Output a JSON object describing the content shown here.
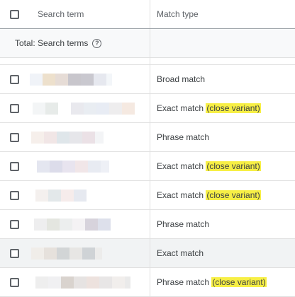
{
  "header": {
    "search_term_label": "Search term",
    "match_type_label": "Match type"
  },
  "total": {
    "label": "Total: Search terms",
    "help_icon": "?"
  },
  "rows": [
    {
      "match": "Broad match",
      "variant": "",
      "blur": [
        [
          "#f0f3f8",
          18
        ],
        [
          "#ede0cc",
          18
        ],
        [
          "#e6dcd6",
          18
        ],
        [
          "#c8c6cc",
          18
        ],
        [
          "#c9c8cf",
          18
        ],
        [
          "#e6e8ef",
          18
        ],
        [
          "#f3f6f9",
          8
        ]
      ],
      "offset": 2
    },
    {
      "match": "Exact match",
      "variant": "(close variant)",
      "blur": [
        [
          "#f3f5f6",
          18
        ],
        [
          "#e7ebe9",
          18
        ],
        [
          "#ffffff",
          18
        ],
        [
          "#e9e9ee",
          18
        ],
        [
          "#e9edf2",
          18
        ],
        [
          "#e8ecf4",
          18
        ],
        [
          "#eeedee",
          18
        ],
        [
          "#f5e9e1",
          18
        ]
      ],
      "offset": 6
    },
    {
      "match": "Phrase match",
      "variant": "",
      "blur": [
        [
          "#f6efeb",
          18
        ],
        [
          "#f1e6e6",
          18
        ],
        [
          "#dfe6ea",
          18
        ],
        [
          "#e6e6ea",
          18
        ],
        [
          "#ebe1e6",
          18
        ],
        [
          "#f3f4f6",
          12
        ]
      ],
      "offset": 4
    },
    {
      "match": "Exact match",
      "variant": "(close variant)",
      "blur": [
        [
          "#e4e6f0",
          18
        ],
        [
          "#dcdcea",
          18
        ],
        [
          "#e8e4ef",
          18
        ],
        [
          "#f1e6e8",
          18
        ],
        [
          "#e8ebf2",
          18
        ],
        [
          "#eef0f6",
          12
        ]
      ],
      "offset": 12
    },
    {
      "match": "Exact match",
      "variant": "(close variant)",
      "blur": [
        [
          "#f4f0ee",
          18
        ],
        [
          "#e3e8ea",
          18
        ],
        [
          "#f6eceb",
          18
        ],
        [
          "#e6e9f0",
          18
        ]
      ],
      "offset": 10
    },
    {
      "match": "Phrase match",
      "variant": "",
      "blur": [
        [
          "#eeeeef",
          18
        ],
        [
          "#e4e6e0",
          18
        ],
        [
          "#eceeee",
          18
        ],
        [
          "#f4f2f4",
          18
        ],
        [
          "#d7d3dc",
          18
        ],
        [
          "#dde0eb",
          18
        ]
      ],
      "offset": 8
    },
    {
      "match": "Exact match",
      "variant": "",
      "blur": [
        [
          "#f0ede9",
          18
        ],
        [
          "#e6e1dc",
          18
        ],
        [
          "#d2d5d6",
          18
        ],
        [
          "#e7e6e4",
          18
        ],
        [
          "#cfd3d6",
          18
        ],
        [
          "#ececeb",
          10
        ]
      ],
      "offset": 4,
      "hover": true
    },
    {
      "match": "Phrase match",
      "variant": "(close variant)",
      "blur": [
        [
          "#eeeeee",
          18
        ],
        [
          "#f0f0f2",
          18
        ],
        [
          "#d9d3ce",
          18
        ],
        [
          "#e6e3e2",
          18
        ],
        [
          "#ede2de",
          18
        ],
        [
          "#e8e6e6",
          18
        ],
        [
          "#f1eeec",
          18
        ],
        [
          "#eaeaea",
          8
        ]
      ],
      "offset": 10
    }
  ]
}
